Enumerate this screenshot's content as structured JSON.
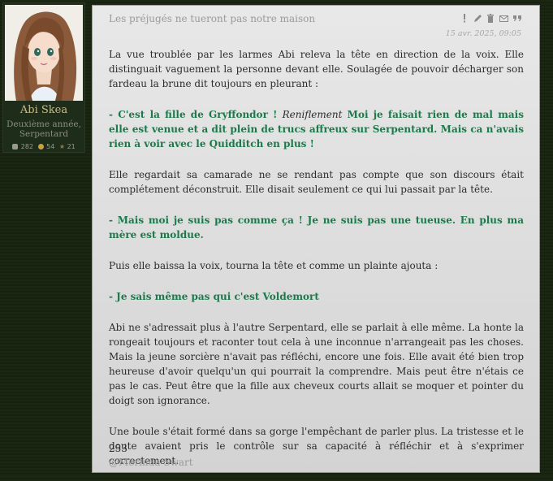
{
  "profile": {
    "name": "Abi Skea",
    "line1": "Deuxième année,",
    "line2": "Serpentard",
    "stats": {
      "posts": "282",
      "galleons": "54",
      "points": "21"
    }
  },
  "post": {
    "title": "Les préjugés ne tueront pas notre maison",
    "date": "15 avr. 2025, 09:05",
    "icons": [
      "report-icon",
      "edit-icon",
      "delete-icon",
      "mail-icon",
      "quote-icon"
    ],
    "paragraphs": {
      "p1": "La vue troublée par les larmes Abi releva la tête en direction de la voix. Elle distinguait vaguement la personne devant elle. Soulagée de pouvoir décharger son fardeau la brune dit toujours en pleurant :",
      "d1a": "- C'est la fille de Gryffondor !",
      "d1b": "Reniflement",
      "d1c": "Moi je faisait rien de mal mais elle est venue et a dit plein de trucs affreux sur Serpentard. Mais ca n'avais rien à voir avec le Quidditch en plus !",
      "p2": "Elle regardait sa camarade ne se rendant pas compte que son discours était complétement déconstruit. Elle disait seulement ce qui lui passait par la tête.",
      "d2": "- Mais moi je suis pas comme ça ! Je ne suis pas une tueuse. En plus ma mère est moldue.",
      "p3": "Puis elle baissa la voix, tourna la tête et comme un plainte ajouta :",
      "d3": "- Je sais même pas qui c'est Voldemort",
      "p4": "Abi ne s'adressait plus à l'autre Serpentard, elle se parlait à elle même. La honte la rongeait toujours et raconter tout cela à une inconnue n'arrangeait pas les choses. Mais la jeune sorcière n'avait pas réfléchi, encore une fois. Elle avait été bien trop heureuse d'avoir quelqu'un qui pourrait la comprendre. Mais peut être n'étais ce pas le cas. Peut être que la fille aux cheveux courts allait se moquer et pointer du doigt son ignorance.",
      "p5": "Une boule s'était formé dans sa gorge l'empêchant de parler plus. La tristesse et le doute avaient pris le contrôle sur sa capacité à réfléchir et à s'exprimer correctement."
    },
    "word_count": "253",
    "tag": "@Merinda Swart"
  },
  "colors": {
    "background": "#17240f",
    "speech": "#1a7a4a",
    "username": "#c6bd8a",
    "galleon": "#c9a23a",
    "points": "#8a7a50"
  }
}
